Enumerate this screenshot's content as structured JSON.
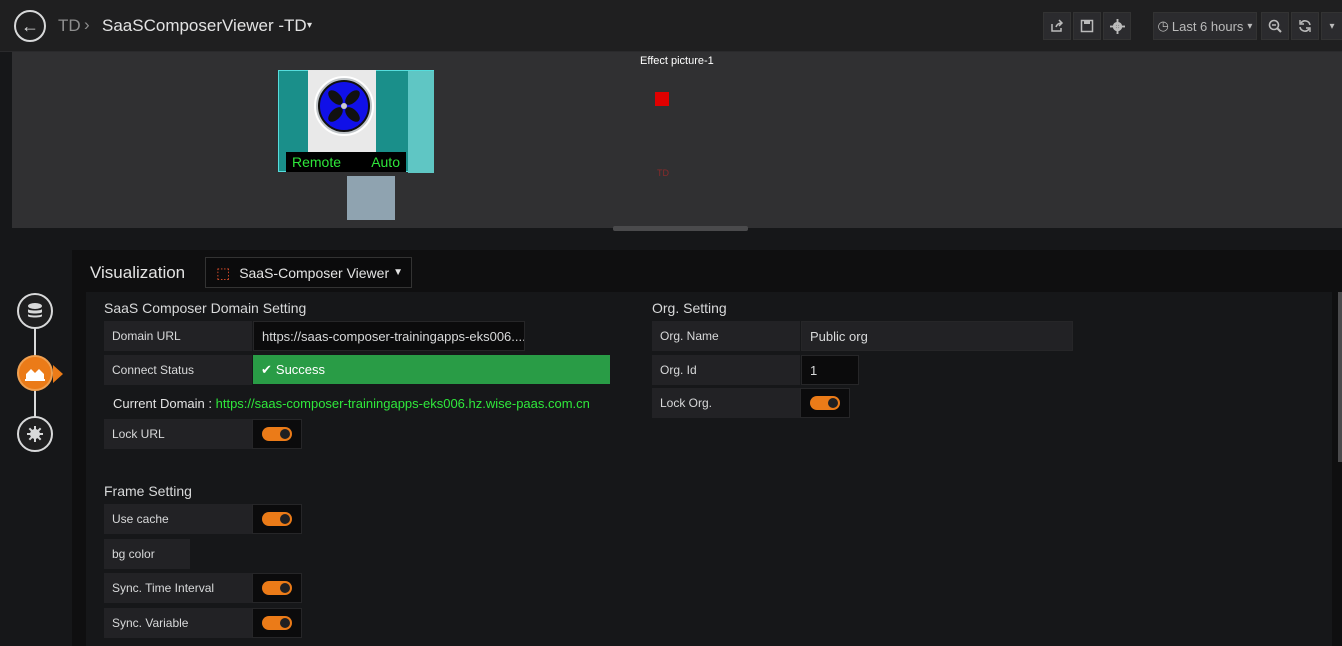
{
  "header": {
    "breadcrumb_root": "TD",
    "breadcrumb_sep": "›",
    "dashboard_title": "SaaSComposerViewer -TD",
    "caret": "▾",
    "time_range": "Last 6 hours",
    "time_caret": "▾"
  },
  "panel": {
    "effect_title": "Effect picture-1",
    "status_left": "Remote",
    "status_right": "Auto",
    "small_label": "TD"
  },
  "editor": {
    "visualization_label": "Visualization",
    "viz_select": "SaaS-Composer Viewer",
    "domain_section": {
      "title": "SaaS Composer Domain Setting",
      "domain_url_label": "Domain URL",
      "domain_url_value": "https://saas-composer-trainingapps-eks006....",
      "connect_status_label": "Connect Status",
      "connect_status_value": "Success",
      "current_domain_label": "Current Domain :",
      "current_domain_value": "https://saas-composer-trainingapps-eks006.hz.wise-paas.com.cn",
      "lock_url_label": "Lock URL",
      "lock_url_on": true
    },
    "frame_section": {
      "title": "Frame Setting",
      "use_cache_label": "Use cache",
      "use_cache_on": true,
      "bg_color_label": "bg color",
      "sync_time_label": "Sync. Time Interval",
      "sync_time_on": true,
      "sync_variable_label": "Sync. Variable",
      "sync_variable_on": true
    },
    "org_section": {
      "title": "Org. Setting",
      "org_name_label": "Org. Name",
      "org_name_value": "Public org",
      "org_id_label": "Org. Id",
      "org_id_value": "1",
      "lock_org_label": "Lock Org.",
      "lock_org_on": true
    }
  },
  "colors": {
    "accent": "#eb7b18",
    "success": "#299c46",
    "domain_text": "#2fe83b"
  }
}
